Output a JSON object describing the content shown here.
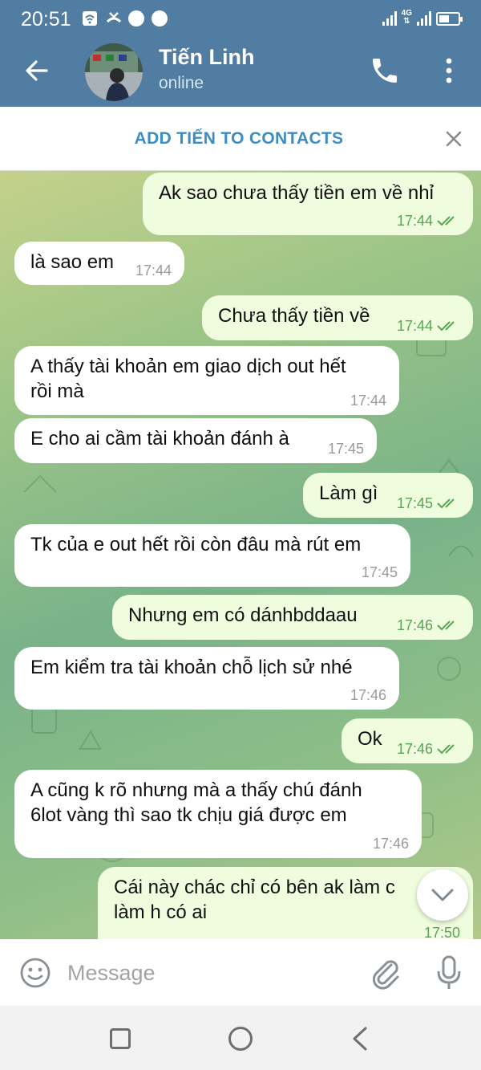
{
  "status_bar": {
    "time": "20:51",
    "network_label": "4G",
    "icons": [
      "wifi-icon",
      "missed-call-icon",
      "chrome-icon",
      "messenger-icon",
      "signal-icon",
      "battery-icon"
    ]
  },
  "header": {
    "contact_name": "Tiến Linh",
    "status": "online",
    "icons": [
      "back-arrow-icon",
      "phone-icon",
      "more-vertical-icon"
    ]
  },
  "contact_bar": {
    "label": "ADD TIẾN TO CONTACTS"
  },
  "messages": [
    {
      "dir": "out",
      "lines": [
        "Ak sao chưa thấy tiền em về nhỉ"
      ],
      "time": "17:44",
      "read": true
    },
    {
      "dir": "in",
      "lines": [
        "là sao em"
      ],
      "time": "17:44"
    },
    {
      "dir": "out",
      "lines": [
        "Chưa thấy tiền về"
      ],
      "time": "17:44",
      "read": true
    },
    {
      "dir": "in",
      "lines": [
        "A thấy tài khoản em giao dịch out hết",
        "rồi mà"
      ],
      "time": "17:44"
    },
    {
      "dir": "in",
      "lines": [
        "E cho ai cầm tài khoản đánh à"
      ],
      "time": "17:45"
    },
    {
      "dir": "out",
      "lines": [
        "Làm gì"
      ],
      "time": "17:45",
      "read": true
    },
    {
      "dir": "in",
      "lines": [
        "Tk của e out hết rồi còn đâu mà rút em"
      ],
      "time": "17:45"
    },
    {
      "dir": "out",
      "lines": [
        "Nhưng em có dánhbddaau"
      ],
      "time": "17:46",
      "read": true
    },
    {
      "dir": "in",
      "lines": [
        "Em kiểm tra tài khoản chỗ lịch sử nhé"
      ],
      "time": "17:46"
    },
    {
      "dir": "out",
      "lines": [
        "Ok"
      ],
      "time": "17:46",
      "read": true
    },
    {
      "dir": "in",
      "lines": [
        "A  cũng k rõ nhưng mà a thấy chú đánh",
        "6lot vàng thì sao tk chịu giá được em"
      ],
      "time": "17:46"
    },
    {
      "dir": "out",
      "lines": [
        "Cái này chác chỉ có bên ak làm c",
        "làm h có ai"
      ],
      "time": "17:50"
    }
  ],
  "composer": {
    "placeholder": "Message",
    "icons": [
      "emoji-icon",
      "attach-icon",
      "mic-icon"
    ]
  },
  "nav_bar": {
    "icons": [
      "recents-icon",
      "home-icon",
      "back-icon"
    ]
  },
  "colors": {
    "header_bg": "#517da2",
    "incoming_bubble": "#ffffff",
    "outgoing_bubble": "#effdde",
    "outgoing_meta": "#59a457",
    "link_blue": "#3d8cc4"
  }
}
